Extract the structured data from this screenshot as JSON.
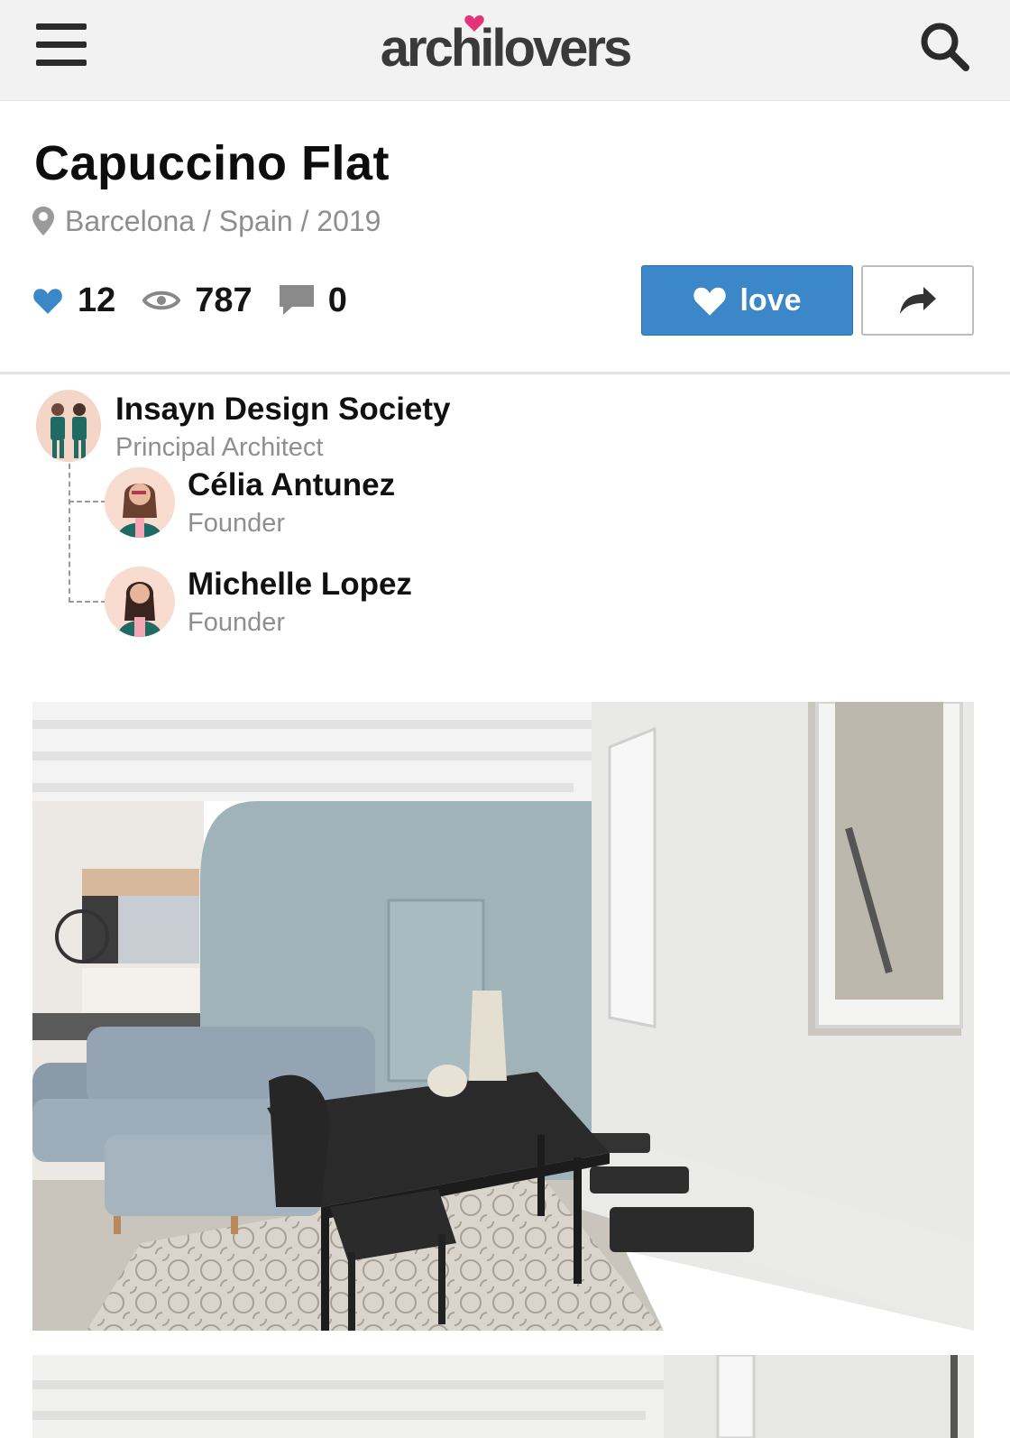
{
  "header": {
    "logo_text": "archilovers",
    "menu_icon": "hamburger-menu-icon",
    "search_icon": "search-icon",
    "logo_heart_color": "#e5337a"
  },
  "project": {
    "title": "Capuccino Flat",
    "location": "Barcelona / Spain / 2019",
    "likes": "12",
    "views": "787",
    "comments": "0"
  },
  "actions": {
    "love_label": "love",
    "accent_color": "#3b87c8"
  },
  "team": {
    "studio": {
      "name": "Insayn Design Society",
      "role": "Principal Architect"
    },
    "members": [
      {
        "name": "Célia Antunez",
        "role": "Founder"
      },
      {
        "name": "Michelle Lopez",
        "role": "Founder"
      }
    ]
  }
}
